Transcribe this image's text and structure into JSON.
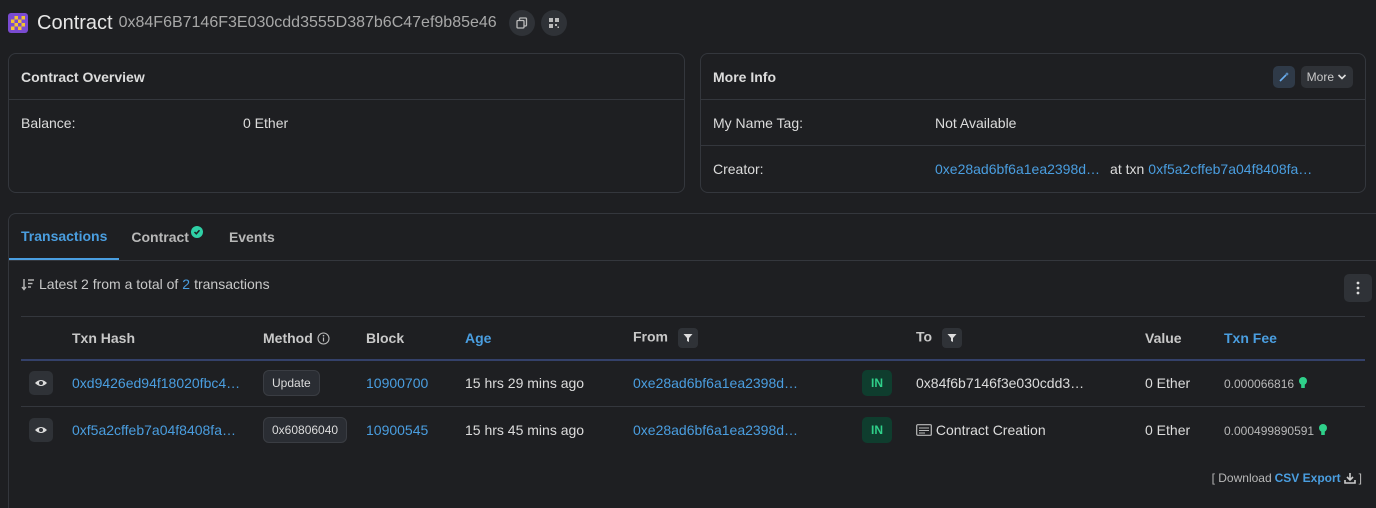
{
  "header": {
    "title": "Contract",
    "address": "0x84F6B7146F3E030cdd3555D387b6C47ef9b85e46"
  },
  "overview": {
    "title": "Contract Overview",
    "balance_label": "Balance:",
    "balance_value": "0 Ether"
  },
  "more_info": {
    "title": "More Info",
    "more_label": "More",
    "name_tag_label": "My Name Tag:",
    "name_tag_value": "Not Available",
    "creator_label": "Creator:",
    "creator_address": "0xe28ad6bf6a1ea2398d…",
    "at_txn_text": "at txn",
    "creator_txn": "0xf5a2cffeb7a04f8408fa…"
  },
  "tabs": [
    "Transactions",
    "Contract",
    "Events"
  ],
  "summary": {
    "prefix": "Latest 2 from a total of",
    "count": "2",
    "suffix": "transactions"
  },
  "table": {
    "headers": {
      "hash": "Txn Hash",
      "method": "Method",
      "block": "Block",
      "age": "Age",
      "from": "From",
      "to": "To",
      "value": "Value",
      "fee": "Txn Fee"
    },
    "rows": [
      {
        "hash": "0xd9426ed94f18020fbc4…",
        "method": "Update",
        "block": "10900700",
        "age": "15 hrs 29 mins ago",
        "from": "0xe28ad6bf6a1ea2398d…",
        "direction": "IN",
        "to": "0x84f6b7146f3e030cdd3…",
        "value": "0 Ether",
        "fee": "0.000066816"
      },
      {
        "hash": "0xf5a2cffeb7a04f8408fa…",
        "method": "0x60806040",
        "block": "10900545",
        "age": "15 hrs 45 mins ago",
        "from": "0xe28ad6bf6a1ea2398d…",
        "direction": "IN",
        "to": "Contract Creation",
        "value": "0 Ether",
        "fee": "0.000499890591"
      }
    ]
  },
  "download": {
    "open_bracket": "[ Download",
    "csv_label": "CSV Export",
    "close_bracket": "]"
  },
  "colors": {
    "background": "#1e1f22",
    "link": "#4a9ee0",
    "in_badge": "#2fd08a",
    "verified": "#2fd0a6"
  }
}
